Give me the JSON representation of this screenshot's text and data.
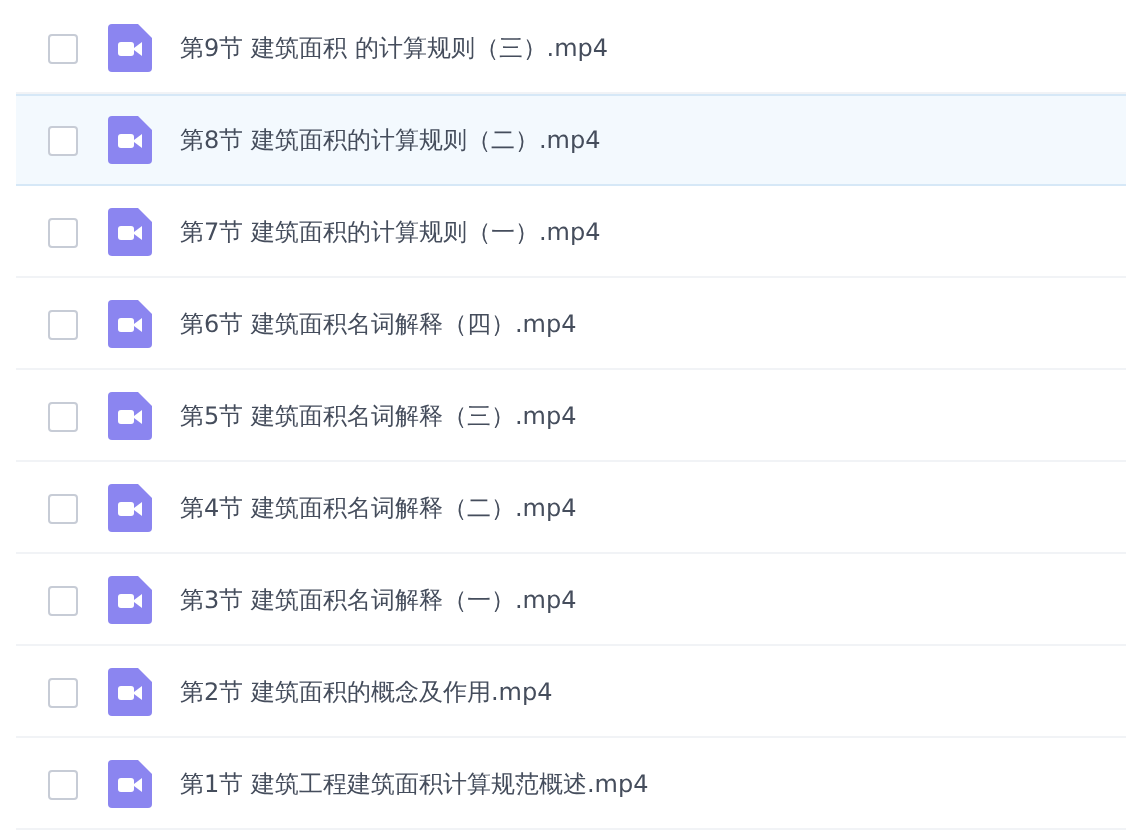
{
  "files": [
    {
      "name": "第9节 建筑面积 的计算规则（三）.mp4",
      "selected": false,
      "checked": false
    },
    {
      "name": "第8节 建筑面积的计算规则（二）.mp4",
      "selected": true,
      "checked": false
    },
    {
      "name": "第7节 建筑面积的计算规则（一）.mp4",
      "selected": false,
      "checked": false
    },
    {
      "name": "第6节 建筑面积名词解释（四）.mp4",
      "selected": false,
      "checked": false
    },
    {
      "name": "第5节 建筑面积名词解释（三）.mp4",
      "selected": false,
      "checked": false
    },
    {
      "name": "第4节 建筑面积名词解释（二）.mp4",
      "selected": false,
      "checked": false
    },
    {
      "name": "第3节 建筑面积名词解释（一）.mp4",
      "selected": false,
      "checked": false
    },
    {
      "name": "第2节 建筑面积的概念及作用.mp4",
      "selected": false,
      "checked": false
    },
    {
      "name": "第1节 建筑工程建筑面积计算规范概述.mp4",
      "selected": false,
      "checked": false
    }
  ]
}
